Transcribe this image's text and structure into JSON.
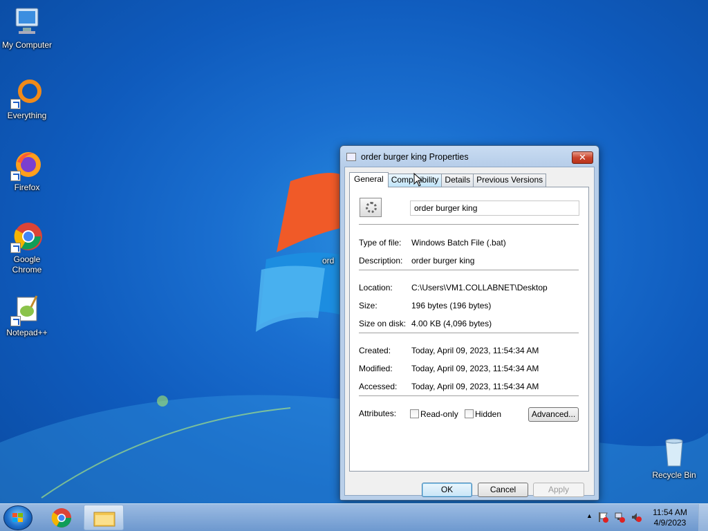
{
  "desktop": {
    "icons": [
      {
        "label": "My Computer"
      },
      {
        "label": "Everything"
      },
      {
        "label": "Firefox"
      },
      {
        "label": "Google Chrome"
      },
      {
        "label": "Notepad++"
      },
      {
        "label": "Recycle Bin"
      }
    ],
    "partial_label": "ord"
  },
  "dialog": {
    "title": "order burger king Properties",
    "close_glyph": "✕",
    "tabs": [
      "General",
      "Compatibility",
      "Details",
      "Previous Versions"
    ],
    "active_tab": "General",
    "file_name": "order burger king",
    "fields": {
      "type_label": "Type of file:",
      "type_value": "Windows Batch File (.bat)",
      "desc_label": "Description:",
      "desc_value": "order burger king",
      "location_label": "Location:",
      "location_value": "C:\\Users\\VM1.COLLABNET\\Desktop",
      "size_label": "Size:",
      "size_value": "196 bytes (196 bytes)",
      "disk_label": "Size on disk:",
      "disk_value": "4.00 KB (4,096 bytes)",
      "created_label": "Created:",
      "created_value": "Today, April 09, 2023, 11:54:34 AM",
      "modified_label": "Modified:",
      "modified_value": "Today, April 09, 2023, 11:54:34 AM",
      "accessed_label": "Accessed:",
      "accessed_value": "Today, April 09, 2023, 11:54:34 AM"
    },
    "attributes_label": "Attributes:",
    "readonly_label": "Read-only",
    "hidden_label": "Hidden",
    "advanced_label": "Advanced...",
    "ok_label": "OK",
    "cancel_label": "Cancel",
    "apply_label": "Apply"
  },
  "taskbar": {
    "clock_time": "11:54 AM",
    "clock_date": "4/9/2023",
    "tray_arrow": "▲"
  },
  "colors": {
    "desktop_blue": "#1a6fd0",
    "close_red": "#c9452d",
    "dialog_frame": "#b9cfe9"
  }
}
